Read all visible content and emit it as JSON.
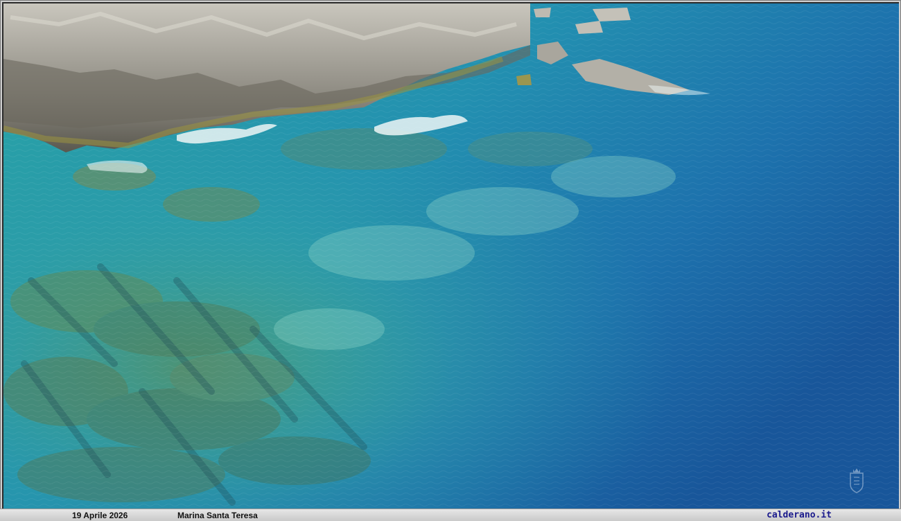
{
  "photo": {
    "subject": "aerial-sea-rocky-coast",
    "colors": {
      "deep_sea": "#1a5e9e",
      "mid_sea": "#1f86ad",
      "shallow_sea": "#2aa3a8",
      "rock_light": "#b9b6ad",
      "rock_dark": "#4a4a44",
      "algae": "#8c8a3a",
      "foam": "#e8f2f4"
    }
  },
  "caption": {
    "date": "19 Aprile 2026",
    "place": "Marina Santa Teresa",
    "site": "calderano.it"
  },
  "watermark": {
    "icon": "crest-icon"
  }
}
